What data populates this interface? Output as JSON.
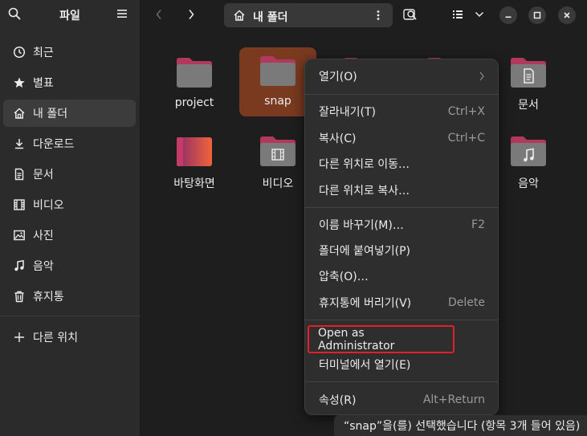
{
  "sidebar": {
    "title": "파일",
    "items": [
      {
        "label": "최근",
        "icon": "clock-icon"
      },
      {
        "label": "별표",
        "icon": "star-icon"
      },
      {
        "label": "내 폴더",
        "icon": "home-icon"
      },
      {
        "label": "다운로드",
        "icon": "download-icon"
      },
      {
        "label": "문서",
        "icon": "document-icon"
      },
      {
        "label": "비디오",
        "icon": "video-icon"
      },
      {
        "label": "사진",
        "icon": "image-icon"
      },
      {
        "label": "음악",
        "icon": "music-icon"
      },
      {
        "label": "휴지통",
        "icon": "trash-icon"
      }
    ],
    "other_locations": "다른 위치"
  },
  "header": {
    "path_label": "내 폴더"
  },
  "files": [
    {
      "name": "project"
    },
    {
      "name": "snap"
    },
    {
      "name": "문서"
    },
    {
      "name": "바탕화면"
    },
    {
      "name": "비디오"
    },
    {
      "name": "음악"
    }
  ],
  "context_menu": {
    "open": {
      "label": "열기(O)"
    },
    "cut": {
      "label": "잘라내기(T)",
      "shortcut": "Ctrl+X"
    },
    "copy": {
      "label": "복사(C)",
      "shortcut": "Ctrl+C"
    },
    "move_to": {
      "label": "다른 위치로 이동…"
    },
    "copy_to": {
      "label": "다른 위치로 복사…"
    },
    "rename": {
      "label": "이름 바꾸기(M)…",
      "shortcut": "F2"
    },
    "paste_into": {
      "label": "폴더에 붙여넣기(P)"
    },
    "compress": {
      "label": "압축(O)…"
    },
    "trash": {
      "label": "휴지통에 버리기(V)",
      "shortcut": "Delete"
    },
    "open_admin": {
      "label": "Open as Administrator"
    },
    "open_terminal": {
      "label": "터미널에서 열기(E)"
    },
    "properties": {
      "label": "속성(R)",
      "shortcut": "Alt+Return"
    }
  },
  "status": {
    "text": "“snap”을(를) 선택했습니다 (항목 3개 들어 있음)"
  },
  "colors": {
    "accent": "#e95420",
    "selection": "#7a3a20",
    "highlight_box": "#e0202a"
  }
}
